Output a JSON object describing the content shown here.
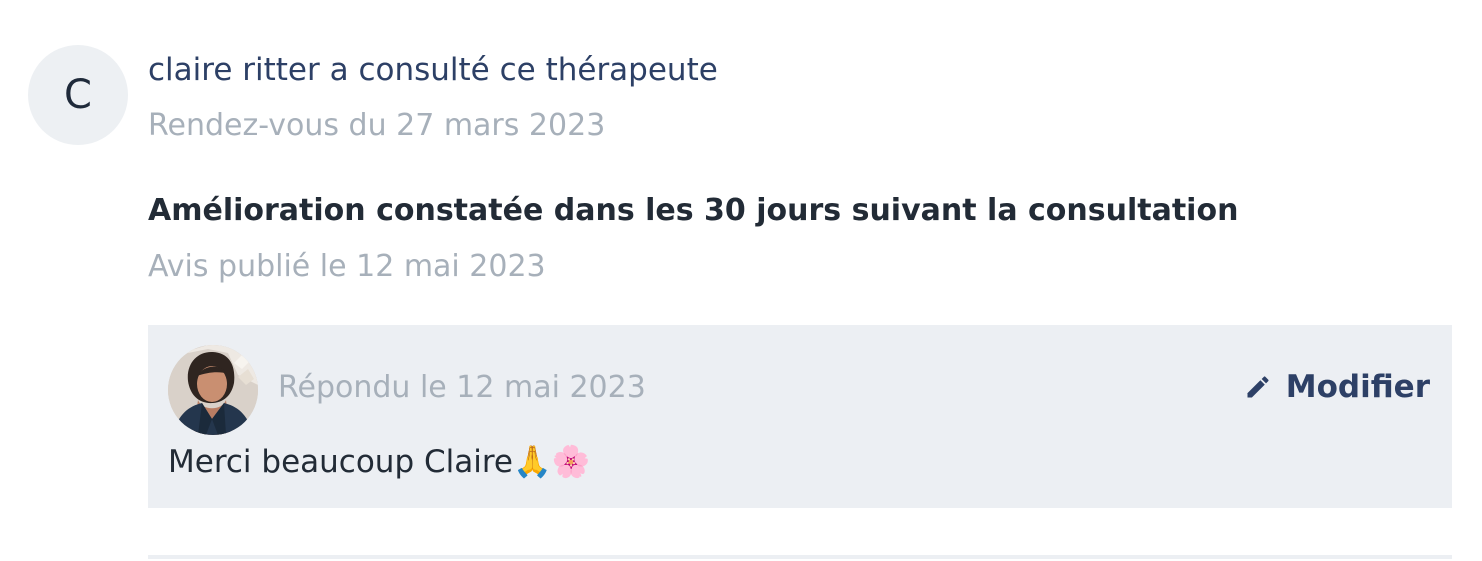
{
  "review": {
    "author_initial": "C",
    "author_line": "claire ritter a consulté ce thérapeute",
    "appointment_date": "Rendez-vous du 27 mars 2023",
    "title": "Amélioration constatée dans les 30 jours suivant la consultation",
    "published_date": "Avis publié le 12 mai 2023"
  },
  "reply": {
    "date": "Répondu le 12 mai 2023",
    "edit_label": "Modifier",
    "edit_icon": "pencil-icon",
    "message": "Merci beaucoup Claire🙏🌸"
  },
  "colors": {
    "accent": "#2d4066",
    "muted_text": "#a7b0ba",
    "reply_background": "#eceff3",
    "avatar_background": "#edf0f3"
  }
}
